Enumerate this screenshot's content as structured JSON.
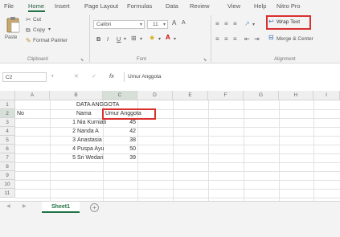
{
  "menu": {
    "tabs": [
      "File",
      "Home",
      "Insert",
      "Page Layout",
      "Formulas",
      "Data",
      "Review",
      "View",
      "Help",
      "Nitro Pro"
    ],
    "active": "Home"
  },
  "ribbon": {
    "clipboard": {
      "paste": "Paste",
      "cut": "Cut",
      "copy": "Copy",
      "format_painter": "Format Painter",
      "label": "Clipboard"
    },
    "font": {
      "name": "Calibri",
      "size": "11",
      "grow": "A",
      "shrink": "A",
      "bold": "B",
      "italic": "I",
      "underline": "U",
      "label": "Font"
    },
    "alignment": {
      "wrap_text": "Wrap Text",
      "merge_center": "Merge & Center",
      "label": "Alignment"
    }
  },
  "formula_bar": {
    "name_box": "C2",
    "cancel": "✕",
    "enter": "✓",
    "fx": "fx",
    "value": "Umur Anggota"
  },
  "grid": {
    "columns": [
      "A",
      "B",
      "C",
      "D",
      "E",
      "F",
      "G",
      "H",
      "I"
    ],
    "rows": [
      "1",
      "2",
      "3",
      "4",
      "5",
      "6",
      "7",
      "8",
      "9",
      "10",
      "11"
    ],
    "title": "DATA ANGGOTA",
    "header": {
      "no": "No",
      "name": "Nama",
      "age": "Umur Anggota"
    },
    "records": [
      {
        "no": "1",
        "name": "Nia Kurniati",
        "age": "45"
      },
      {
        "no": "2",
        "name": "Nanda A",
        "age": "42"
      },
      {
        "no": "3",
        "name": "Anastasia",
        "age": "38"
      },
      {
        "no": "4",
        "name": "Puspa Ayu",
        "age": "50"
      },
      {
        "no": "5",
        "name": "Sri Wedari",
        "age": "39"
      }
    ]
  },
  "sheets": {
    "active": "Sheet1",
    "add": "+"
  },
  "colors": {
    "accent": "#217346",
    "highlight": "#d9302f"
  }
}
